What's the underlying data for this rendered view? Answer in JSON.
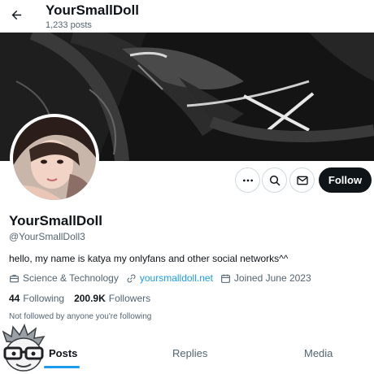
{
  "header": {
    "back_icon": "arrow-left-icon",
    "display_name": "YourSmallDoll",
    "post_count": "1,233 posts"
  },
  "profile": {
    "display_name": "YourSmallDoll",
    "handle": "@YourSmallDoll3",
    "bio": "hello, my name is katya my onlyfans and other social networks^^",
    "category": "Science & Technology",
    "website": "yoursmalldoll.net",
    "joined": "Joined June 2023",
    "following_count": "44",
    "following_label": "Following",
    "followers_count": "200.9K",
    "followers_label": "Followers",
    "not_followed_text": "Not followed by anyone you're following"
  },
  "actions": {
    "more_icon": "more-icon",
    "search_icon": "search-icon",
    "message_icon": "mail-icon",
    "follow_label": "Follow"
  },
  "tabs": [
    {
      "label": "Posts",
      "active": true
    },
    {
      "label": "Replies",
      "active": false
    },
    {
      "label": "Media",
      "active": false
    }
  ],
  "colors": {
    "accent": "#1d9bf0",
    "text_primary": "#0f1419",
    "text_secondary": "#536471",
    "follow_button_bg": "#0f1419"
  }
}
